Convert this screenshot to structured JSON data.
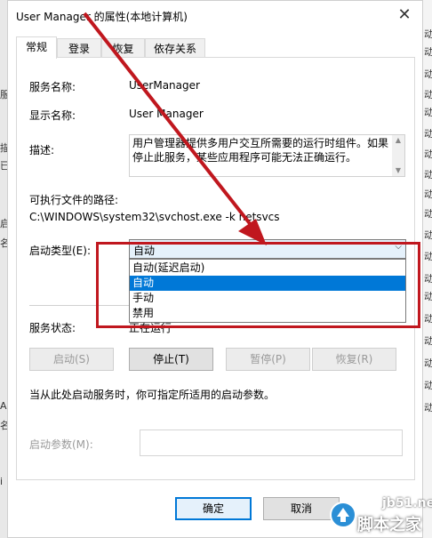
{
  "dialog": {
    "title": "User Manager 的属性(本地计算机)",
    "close_glyph": "✕"
  },
  "tabs": [
    {
      "label": "常规",
      "active": true
    },
    {
      "label": "登录",
      "active": false
    },
    {
      "label": "恢复",
      "active": false
    },
    {
      "label": "依存关系",
      "active": false
    }
  ],
  "general": {
    "service_name_label": "服务名称:",
    "service_name_value": "UserManager",
    "display_name_label": "显示名称:",
    "display_name_value": "User Manager",
    "description_label": "描述:",
    "description_text": "用户管理器提供多用户交互所需要的运行时组件。如果停止此服务，某些应用程序可能无法正确运行。",
    "exec_path_label": "可执行文件的路径:",
    "exec_path_value": "C:\\WINDOWS\\system32\\svchost.exe -k netsvcs",
    "startup_type_label": "启动类型(E):",
    "startup_type_selected": "自动",
    "startup_options": [
      "自动(延迟启动)",
      "自动",
      "手动",
      "禁用"
    ],
    "service_status_label": "服务状态:",
    "service_status_value": "正在运行",
    "start_hint": "当从此处启动服务时，你可指定所适用的启动参数。",
    "start_params_label": "启动参数(M):",
    "start_params_value": ""
  },
  "buttons": {
    "start": "启动(S)",
    "stop": "停止(T)",
    "pause": "暂停(P)",
    "resume": "恢复(R)",
    "ok": "确定",
    "cancel": "取消"
  },
  "background": {
    "left_glyphs": [
      "服",
      "描",
      "已",
      "启",
      "名",
      "A",
      "名",
      "i"
    ],
    "right_glyphs": [
      "动",
      "动",
      "动",
      "动",
      "动",
      "动",
      "动",
      "动",
      "动",
      "动",
      "动",
      "动",
      "动",
      "动",
      "动",
      "动",
      "动",
      "动",
      "动"
    ]
  },
  "watermark": {
    "site": "jb51.net",
    "name": "脚本之家"
  },
  "colors": {
    "annotation_red": "#c0171e",
    "selection_blue": "#0078d7"
  }
}
